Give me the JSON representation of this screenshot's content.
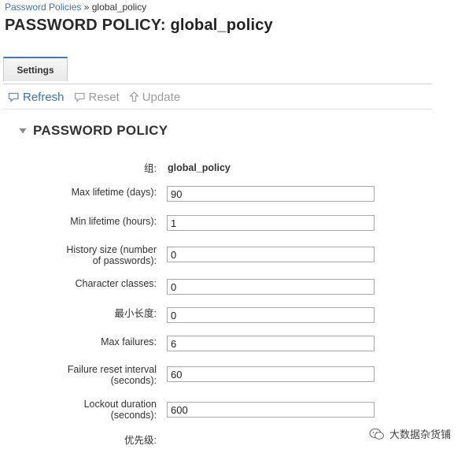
{
  "breadcrumb": {
    "parent": "Password Policies",
    "separator": "»",
    "current": "global_policy"
  },
  "page": {
    "title_prefix": "PASSWORD POLICY:",
    "title_name": "global_policy"
  },
  "tabs": [
    {
      "label": "Settings",
      "active": true
    }
  ],
  "actions": {
    "refresh": {
      "label": "Refresh",
      "icon": "refresh-icon"
    },
    "reset": {
      "label": "Reset",
      "icon": "reset-icon"
    },
    "update": {
      "label": "Update",
      "icon": "update-icon"
    }
  },
  "section": {
    "title": "PASSWORD POLICY",
    "icon": "collapse-triangle-icon"
  },
  "fields": {
    "group": {
      "label": "组:",
      "value": "global_policy"
    },
    "max_lifetime": {
      "label": "Max lifetime (days):",
      "value": "90"
    },
    "min_lifetime": {
      "label": "Min lifetime (hours):",
      "value": "1"
    },
    "history_size": {
      "label_line1": "History size (number",
      "label_line2": "of passwords):",
      "value": "0"
    },
    "character_classes": {
      "label": "Character classes:",
      "value": "0"
    },
    "min_length": {
      "label": "最小长度:",
      "value": "0"
    },
    "max_failures": {
      "label": "Max failures:",
      "value": "6"
    },
    "failure_reset": {
      "label_line1": "Failure reset interval",
      "label_line2": "(seconds):",
      "value": "60"
    },
    "lockout_duration": {
      "label_line1": "Lockout duration",
      "label_line2": "(seconds):",
      "value": "600"
    },
    "priority": {
      "label": "优先级:"
    }
  },
  "watermark": {
    "text": "大数据杂货铺",
    "icon": "wechat-icon"
  },
  "colors": {
    "link": "#3b73b9",
    "tab_accent": "#3f7ac4",
    "disabled": "#9a9a9a"
  }
}
